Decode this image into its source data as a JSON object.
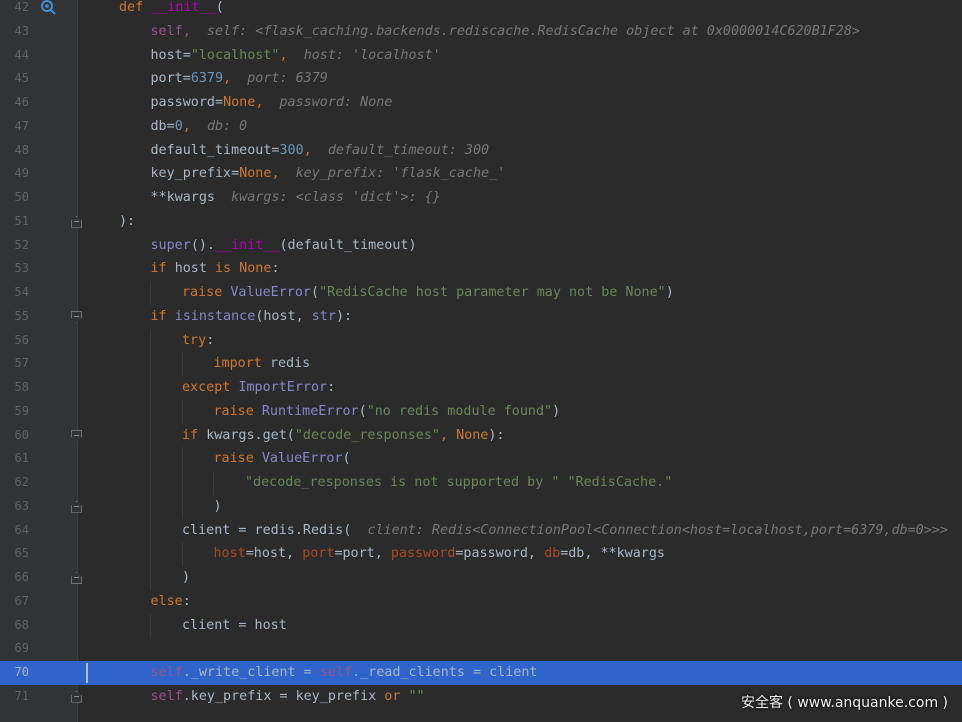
{
  "editor": {
    "language": "python",
    "current_line": "70",
    "watermark": "安全客 ( www.anquanke.com )",
    "lines": [
      {
        "n": "42",
        "fold": "",
        "icon": "debug-step-icon",
        "indent": 0,
        "tokens": [
          {
            "t": "def ",
            "c": "kw"
          },
          {
            "t": "__init__",
            "c": "magic"
          },
          {
            "t": "(",
            "c": "plain"
          }
        ]
      },
      {
        "n": "43",
        "indent": 1,
        "tokens": [
          {
            "t": "self,",
            "c": "self"
          },
          {
            "t": "  self: <flask_caching.backends.rediscache.RedisCache object at 0x0000014C620B1F28>",
            "c": "hint"
          }
        ]
      },
      {
        "n": "44",
        "indent": 1,
        "tokens": [
          {
            "t": "host=",
            "c": "plain"
          },
          {
            "t": "\"localhost\"",
            "c": "str"
          },
          {
            "t": ",  ",
            "c": "kw"
          },
          {
            "t": "host: 'localhost'",
            "c": "hint"
          }
        ]
      },
      {
        "n": "45",
        "indent": 1,
        "tokens": [
          {
            "t": "port=",
            "c": "plain"
          },
          {
            "t": "6379",
            "c": "num-lit"
          },
          {
            "t": ",  ",
            "c": "kw"
          },
          {
            "t": "port: 6379",
            "c": "hint"
          }
        ]
      },
      {
        "n": "46",
        "indent": 1,
        "tokens": [
          {
            "t": "password=",
            "c": "plain"
          },
          {
            "t": "None",
            "c": "none"
          },
          {
            "t": ",  ",
            "c": "kw"
          },
          {
            "t": "password: None",
            "c": "hint"
          }
        ]
      },
      {
        "n": "47",
        "indent": 1,
        "tokens": [
          {
            "t": "db=",
            "c": "plain"
          },
          {
            "t": "0",
            "c": "num-lit"
          },
          {
            "t": ",  ",
            "c": "kw"
          },
          {
            "t": "db: 0",
            "c": "hint"
          }
        ]
      },
      {
        "n": "48",
        "indent": 1,
        "tokens": [
          {
            "t": "default_timeout=",
            "c": "plain"
          },
          {
            "t": "300",
            "c": "num-lit"
          },
          {
            "t": ",  ",
            "c": "kw"
          },
          {
            "t": "default_timeout: 300",
            "c": "hint"
          }
        ]
      },
      {
        "n": "49",
        "indent": 1,
        "tokens": [
          {
            "t": "key_prefix=",
            "c": "plain"
          },
          {
            "t": "None",
            "c": "none"
          },
          {
            "t": ",  ",
            "c": "kw"
          },
          {
            "t": "key_prefix: 'flask_cache_'",
            "c": "hint"
          }
        ]
      },
      {
        "n": "50",
        "indent": 1,
        "tokens": [
          {
            "t": "**kwargs  ",
            "c": "plain"
          },
          {
            "t": "kwargs: <class 'dict'>: {}",
            "c": "hint"
          }
        ]
      },
      {
        "n": "51",
        "fold": "close",
        "indent": 0,
        "tokens": [
          {
            "t": "):",
            "c": "plain"
          }
        ]
      },
      {
        "n": "52",
        "indent": 1,
        "tokens": [
          {
            "t": "super",
            "c": "builtin"
          },
          {
            "t": "().",
            "c": "plain"
          },
          {
            "t": "__init__",
            "c": "magic"
          },
          {
            "t": "(default_timeout)",
            "c": "plain"
          }
        ]
      },
      {
        "n": "53",
        "indent": 1,
        "tokens": [
          {
            "t": "if ",
            "c": "kw"
          },
          {
            "t": "host ",
            "c": "plain"
          },
          {
            "t": "is None",
            "c": "kw"
          },
          {
            "t": ":",
            "c": "plain"
          }
        ]
      },
      {
        "n": "54",
        "indent": 2,
        "tokens": [
          {
            "t": "raise ",
            "c": "kw"
          },
          {
            "t": "ValueError",
            "c": "builtin"
          },
          {
            "t": "(",
            "c": "plain"
          },
          {
            "t": "\"RedisCache host parameter may not be None\"",
            "c": "str"
          },
          {
            "t": ")",
            "c": "plain"
          }
        ]
      },
      {
        "n": "55",
        "fold": "open",
        "indent": 1,
        "tokens": [
          {
            "t": "if ",
            "c": "kw"
          },
          {
            "t": "isinstance",
            "c": "builtin"
          },
          {
            "t": "(host, ",
            "c": "plain"
          },
          {
            "t": "str",
            "c": "builtin"
          },
          {
            "t": "):",
            "c": "plain"
          }
        ]
      },
      {
        "n": "56",
        "indent": 2,
        "tokens": [
          {
            "t": "try",
            "c": "kw"
          },
          {
            "t": ":",
            "c": "plain"
          }
        ]
      },
      {
        "n": "57",
        "indent": 3,
        "tokens": [
          {
            "t": "import ",
            "c": "kw"
          },
          {
            "t": "redis",
            "c": "plain"
          }
        ]
      },
      {
        "n": "58",
        "indent": 2,
        "tokens": [
          {
            "t": "except ",
            "c": "kw"
          },
          {
            "t": "ImportError",
            "c": "builtin"
          },
          {
            "t": ":",
            "c": "plain"
          }
        ]
      },
      {
        "n": "59",
        "indent": 3,
        "tokens": [
          {
            "t": "raise ",
            "c": "kw"
          },
          {
            "t": "RuntimeError",
            "c": "builtin"
          },
          {
            "t": "(",
            "c": "plain"
          },
          {
            "t": "\"no redis module found\"",
            "c": "str"
          },
          {
            "t": ")",
            "c": "plain"
          }
        ]
      },
      {
        "n": "60",
        "fold": "open",
        "indent": 2,
        "tokens": [
          {
            "t": "if ",
            "c": "kw"
          },
          {
            "t": "kwargs.get(",
            "c": "plain"
          },
          {
            "t": "\"decode_responses\"",
            "c": "str"
          },
          {
            "t": ", ",
            "c": "kw"
          },
          {
            "t": "None",
            "c": "none"
          },
          {
            "t": "):",
            "c": "plain"
          }
        ]
      },
      {
        "n": "61",
        "indent": 3,
        "tokens": [
          {
            "t": "raise ",
            "c": "kw"
          },
          {
            "t": "ValueError",
            "c": "builtin"
          },
          {
            "t": "(",
            "c": "plain"
          }
        ]
      },
      {
        "n": "62",
        "indent": 4,
        "tokens": [
          {
            "t": "\"decode_responses is not supported by \" \"RedisCache.\"",
            "c": "str"
          }
        ]
      },
      {
        "n": "63",
        "fold": "close",
        "indent": 3,
        "tokens": [
          {
            "t": ")",
            "c": "plain"
          }
        ]
      },
      {
        "n": "64",
        "indent": 2,
        "tokens": [
          {
            "t": "client = redis.Redis(  ",
            "c": "plain"
          },
          {
            "t": "client: Redis<ConnectionPool<Connection<host=localhost,port=6379,db=0>>>",
            "c": "hint"
          }
        ]
      },
      {
        "n": "65",
        "indent": 3,
        "tokens": [
          {
            "t": "host",
            "c": "param"
          },
          {
            "t": "=host, ",
            "c": "plain"
          },
          {
            "t": "port",
            "c": "param"
          },
          {
            "t": "=port, ",
            "c": "plain"
          },
          {
            "t": "password",
            "c": "param"
          },
          {
            "t": "=password, ",
            "c": "plain"
          },
          {
            "t": "db",
            "c": "param"
          },
          {
            "t": "=db, **kwargs",
            "c": "plain"
          }
        ]
      },
      {
        "n": "66",
        "fold": "close",
        "indent": 2,
        "tokens": [
          {
            "t": ")",
            "c": "plain"
          }
        ]
      },
      {
        "n": "67",
        "indent": 1,
        "tokens": [
          {
            "t": "else",
            "c": "kw"
          },
          {
            "t": ":",
            "c": "plain"
          }
        ]
      },
      {
        "n": "68",
        "indent": 2,
        "tokens": [
          {
            "t": "client = host",
            "c": "plain"
          }
        ]
      },
      {
        "n": "69",
        "indent": 0,
        "tokens": []
      },
      {
        "n": "70",
        "indent": 1,
        "current": true,
        "tokens": [
          {
            "t": "self",
            "c": "self"
          },
          {
            "t": "._write_client = ",
            "c": "plain"
          },
          {
            "t": "self",
            "c": "self"
          },
          {
            "t": "._read_clients = client",
            "c": "plain"
          }
        ]
      },
      {
        "n": "71",
        "fold": "close",
        "indent": 1,
        "tokens": [
          {
            "t": "self",
            "c": "self"
          },
          {
            "t": ".key_prefix = key_prefix ",
            "c": "plain"
          },
          {
            "t": "or ",
            "c": "kw"
          },
          {
            "t": "\"\"",
            "c": "str"
          }
        ]
      }
    ]
  }
}
